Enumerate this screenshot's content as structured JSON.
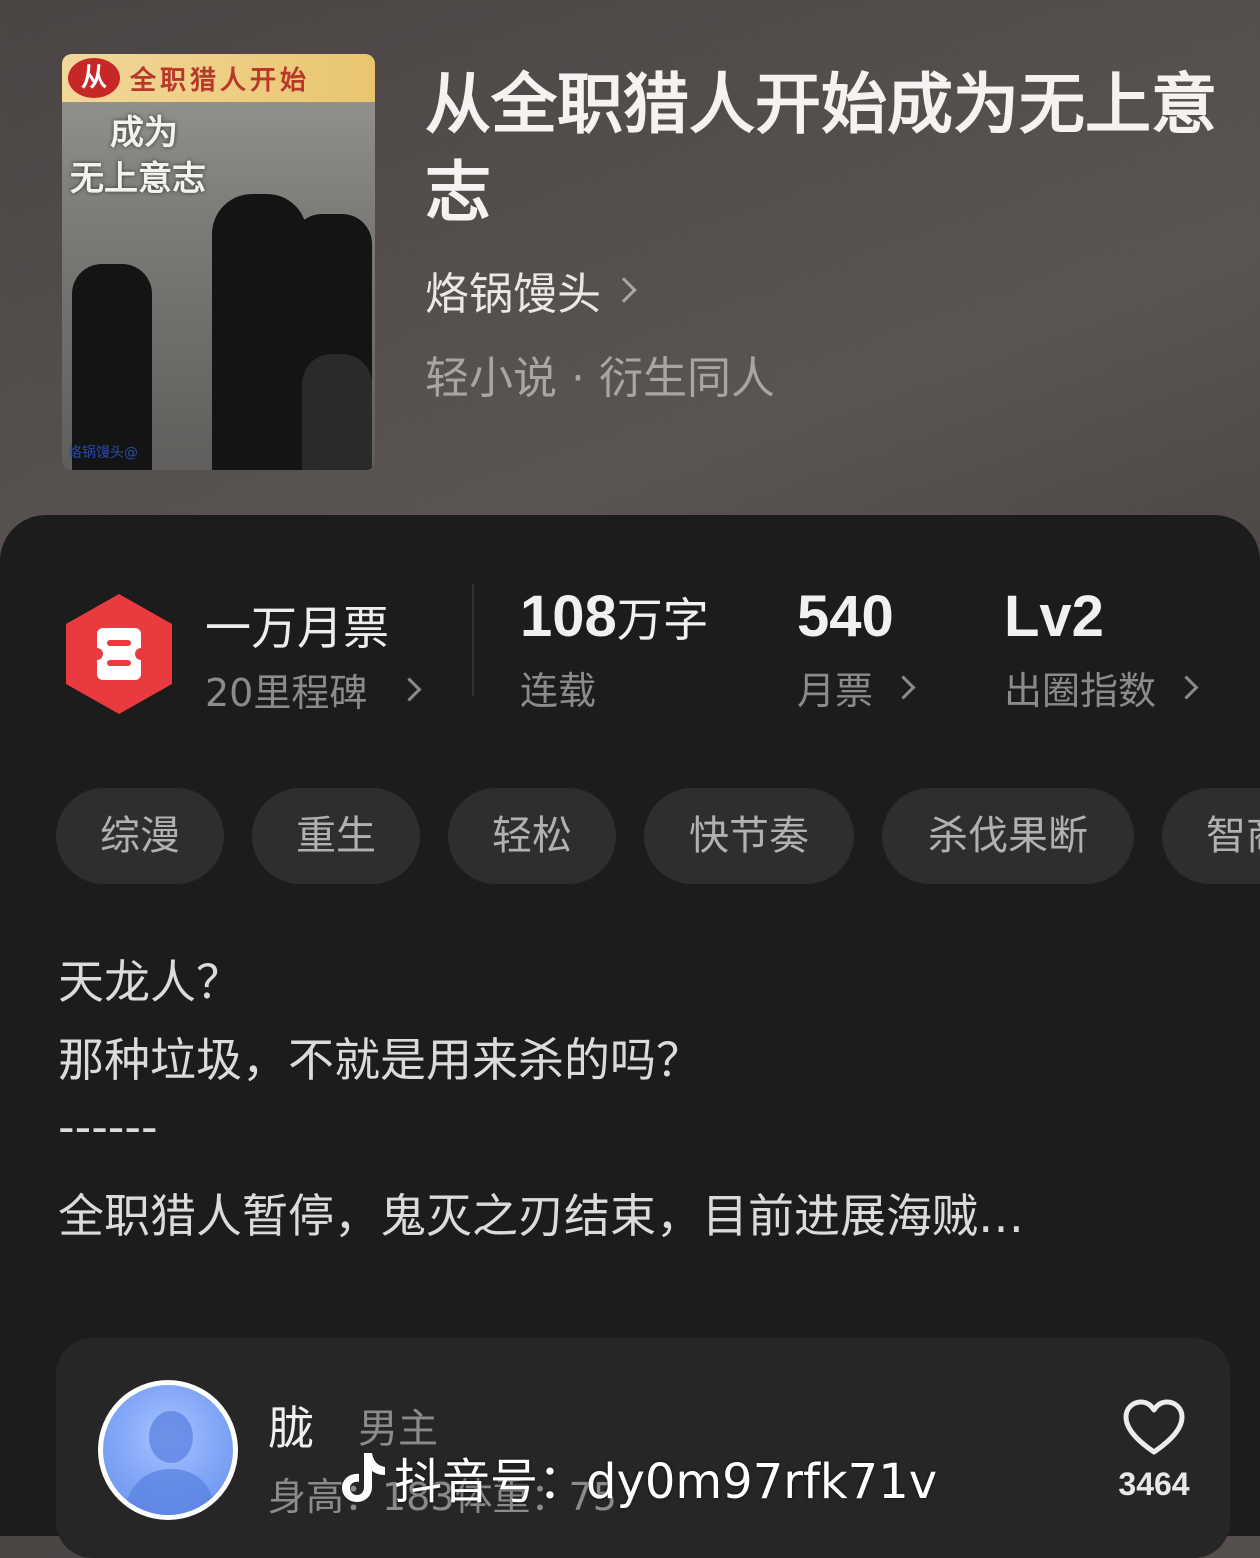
{
  "book": {
    "cover": {
      "badge": "从",
      "strip_text": "全职猎人开始",
      "sub_line1": "成为",
      "sub_line2": "无上意志",
      "artist": "烙锅馒头@"
    },
    "title": "从全职猎人开始成为无上意志",
    "author": "烙锅馒头",
    "genre": "轻小说 · 衍生同人"
  },
  "stats": {
    "ticket": {
      "main": "一万月票",
      "sub": "20里程碑",
      "icon": "ticket-hex-icon",
      "color": "#e83a3f"
    },
    "words": {
      "value": "108",
      "unit": "万字",
      "label": "连载"
    },
    "monthly": {
      "value": "540",
      "label": "月票"
    },
    "level": {
      "value": "Lv2",
      "label": "出圈指数"
    }
  },
  "tags": [
    "综漫",
    "重生",
    "轻松",
    "快节奏",
    "杀伐果断",
    "智商"
  ],
  "description": {
    "lines": [
      "天龙人？",
      "那种垃圾，不就是用来杀的吗？",
      "------",
      "全职猎人暂停，鬼灭之刃结束，目前进展海贼…"
    ]
  },
  "character": {
    "name": "胧",
    "role": "男主",
    "info": "身高：183体重：75",
    "likes": "3464"
  },
  "watermark": {
    "text": "抖音号：dy0m97rfk71v",
    "icon": "douyin-icon"
  }
}
